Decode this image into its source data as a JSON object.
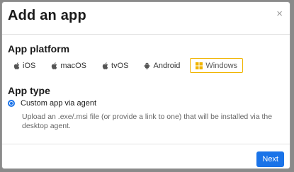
{
  "modal": {
    "title": "Add an app",
    "close_icon": "close-icon",
    "close_glyph": "×"
  },
  "platform_section": {
    "title": "App platform",
    "options": [
      {
        "label": "iOS",
        "icon": "apple-icon",
        "selected": false
      },
      {
        "label": "macOS",
        "icon": "apple-icon",
        "selected": false
      },
      {
        "label": "tvOS",
        "icon": "apple-icon",
        "selected": false
      },
      {
        "label": "Android",
        "icon": "android-icon",
        "selected": false
      },
      {
        "label": "Windows",
        "icon": "windows-icon",
        "selected": true
      }
    ]
  },
  "type_section": {
    "title": "App type",
    "option_label": "Custom app via agent",
    "option_selected": true,
    "option_description": "Upload an .exe/.msi file (or provide a link to one) that will be installed via the desktop agent."
  },
  "footer": {
    "next_label": "Next"
  },
  "colors": {
    "primary": "#1a73e8",
    "selected_border": "#f0b400",
    "windows_icon": "#f0b400"
  }
}
